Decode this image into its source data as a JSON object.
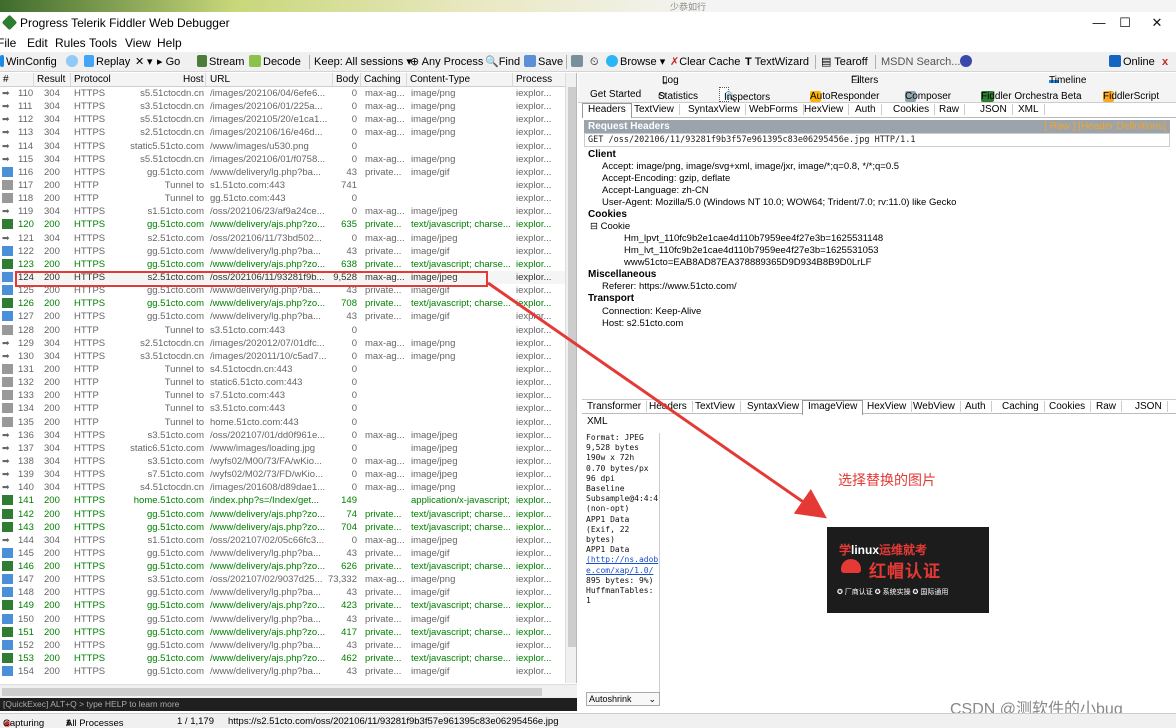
{
  "topstrip": {
    "mark": "少恭如行"
  },
  "window": {
    "title": "Progress Telerik Fiddler Web Debugger",
    "minimize": "—",
    "maximize": "☐",
    "close": "✕"
  },
  "menu": [
    "File",
    "Edit",
    "Rules",
    "Tools",
    "View",
    "Help"
  ],
  "toolbar": {
    "winconfig": "WinConfig",
    "replay": "Replay",
    "remove": "✕",
    "go": "Go",
    "stream": "Stream",
    "decode": "Decode",
    "keep": "Keep: All sessions",
    "any_process": "Any Process",
    "find": "Find",
    "save": "Save",
    "browse": "Browse",
    "clear_cache": "Clear Cache",
    "textwizard": "TextWizard",
    "tearoff": "Tearoff",
    "msdn_search": "MSDN Search...",
    "online": "Online",
    "close": "x"
  },
  "columns": [
    "#",
    "Result",
    "Protocol",
    "Host",
    "URL",
    "Body",
    "Caching",
    "Content-Type",
    "Process"
  ],
  "sessions": [
    {
      "id": "110",
      "result": "304",
      "protocol": "HTTPS",
      "host": "s5.51ctocdn.cn",
      "url": "/images/202106/04/6efe6...",
      "body": "0",
      "caching": "max-ag...",
      "ctype": "image/png",
      "process": "iexplor...",
      "style": "gray",
      "icon": "arrow"
    },
    {
      "id": "111",
      "result": "304",
      "protocol": "HTTPS",
      "host": "s3.51ctocdn.cn",
      "url": "/images/202106/01/225a...",
      "body": "0",
      "caching": "max-ag...",
      "ctype": "image/png",
      "process": "iexplor...",
      "style": "gray",
      "icon": "arrow"
    },
    {
      "id": "112",
      "result": "304",
      "protocol": "HTTPS",
      "host": "s5.51ctocdn.cn",
      "url": "/images/202105/20/e1ca1...",
      "body": "0",
      "caching": "max-ag...",
      "ctype": "image/png",
      "process": "iexplor...",
      "style": "gray",
      "icon": "arrow"
    },
    {
      "id": "113",
      "result": "304",
      "protocol": "HTTPS",
      "host": "s2.51ctocdn.cn",
      "url": "/images/202106/16/e46d...",
      "body": "0",
      "caching": "max-ag...",
      "ctype": "image/png",
      "process": "iexplor...",
      "style": "gray",
      "icon": "arrow"
    },
    {
      "id": "114",
      "result": "304",
      "protocol": "HTTPS",
      "host": "static5.51cto.com",
      "url": "/www/images/u530.png",
      "body": "0",
      "caching": "",
      "ctype": "",
      "process": "iexplor...",
      "style": "gray",
      "icon": "arrow"
    },
    {
      "id": "115",
      "result": "304",
      "protocol": "HTTPS",
      "host": "s5.51ctocdn.cn",
      "url": "/images/202106/01/f0758...",
      "body": "0",
      "caching": "max-ag...",
      "ctype": "image/png",
      "process": "iexplor...",
      "style": "gray",
      "icon": "arrow"
    },
    {
      "id": "116",
      "result": "200",
      "protocol": "HTTPS",
      "host": "gg.51cto.com",
      "url": "/www/delivery/lg.php?ba...",
      "body": "43",
      "caching": "private...",
      "ctype": "image/gif",
      "process": "iexplor...",
      "style": "gray",
      "icon": "img"
    },
    {
      "id": "117",
      "result": "200",
      "protocol": "HTTP",
      "host": "Tunnel to",
      "url": "s1.51cto.com:443",
      "body": "741",
      "caching": "",
      "ctype": "",
      "process": "iexplor...",
      "style": "gray",
      "icon": "lock"
    },
    {
      "id": "118",
      "result": "200",
      "protocol": "HTTP",
      "host": "Tunnel to",
      "url": "gg.51cto.com:443",
      "body": "0",
      "caching": "",
      "ctype": "",
      "process": "iexplor...",
      "style": "gray",
      "icon": "lock"
    },
    {
      "id": "119",
      "result": "304",
      "protocol": "HTTPS",
      "host": "s1.51cto.com",
      "url": "/oss/202106/23/af9a24ce...",
      "body": "0",
      "caching": "max-ag...",
      "ctype": "image/jpeg",
      "process": "iexplor...",
      "style": "gray",
      "icon": "arrow"
    },
    {
      "id": "120",
      "result": "200",
      "protocol": "HTTPS",
      "host": "gg.51cto.com",
      "url": "/www/delivery/ajs.php?zo...",
      "body": "635",
      "caching": "private...",
      "ctype": "text/javascript; charse...",
      "process": "iexplor...",
      "style": "green",
      "icon": "js"
    },
    {
      "id": "121",
      "result": "304",
      "protocol": "HTTPS",
      "host": "s2.51cto.com",
      "url": "/oss/202106/11/73bd502...",
      "body": "0",
      "caching": "max-ag...",
      "ctype": "image/jpeg",
      "process": "iexplor...",
      "style": "gray",
      "icon": "arrow"
    },
    {
      "id": "122",
      "result": "200",
      "protocol": "HTTPS",
      "host": "gg.51cto.com",
      "url": "/www/delivery/lg.php?ba...",
      "body": "43",
      "caching": "private...",
      "ctype": "image/gif",
      "process": "iexplor...",
      "style": "gray",
      "icon": "img"
    },
    {
      "id": "123",
      "result": "200",
      "protocol": "HTTPS",
      "host": "gg.51cto.com",
      "url": "/www/delivery/ajs.php?zo...",
      "body": "638",
      "caching": "private...",
      "ctype": "text/javascript; charse...",
      "process": "iexplor...",
      "style": "green",
      "icon": "js"
    },
    {
      "id": "124",
      "result": "200",
      "protocol": "HTTPS",
      "host": "s2.51cto.com",
      "url": "/oss/202106/11/93281f9b...",
      "body": "9,528",
      "caching": "max-ag...",
      "ctype": "image/jpeg",
      "process": "iexplor...",
      "style": "sel",
      "icon": "img"
    },
    {
      "id": "125",
      "result": "200",
      "protocol": "HTTPS",
      "host": "gg.51cto.com",
      "url": "/www/delivery/lg.php?ba...",
      "body": "43",
      "caching": "private...",
      "ctype": "image/gif",
      "process": "iexplor...",
      "style": "gray",
      "icon": "img"
    },
    {
      "id": "126",
      "result": "200",
      "protocol": "HTTPS",
      "host": "gg.51cto.com",
      "url": "/www/delivery/ajs.php?zo...",
      "body": "708",
      "caching": "private...",
      "ctype": "text/javascript; charse...",
      "process": "iexplor...",
      "style": "green",
      "icon": "js"
    },
    {
      "id": "127",
      "result": "200",
      "protocol": "HTTPS",
      "host": "gg.51cto.com",
      "url": "/www/delivery/lg.php?ba...",
      "body": "43",
      "caching": "private...",
      "ctype": "image/gif",
      "process": "iexplor...",
      "style": "gray",
      "icon": "img"
    },
    {
      "id": "128",
      "result": "200",
      "protocol": "HTTP",
      "host": "Tunnel to",
      "url": "s3.51cto.com:443",
      "body": "0",
      "caching": "",
      "ctype": "",
      "process": "iexplor...",
      "style": "gray",
      "icon": "lock"
    },
    {
      "id": "129",
      "result": "304",
      "protocol": "HTTPS",
      "host": "s2.51ctocdn.cn",
      "url": "/images/202012/07/01dfc...",
      "body": "0",
      "caching": "max-ag...",
      "ctype": "image/png",
      "process": "iexplor...",
      "style": "gray",
      "icon": "arrow"
    },
    {
      "id": "130",
      "result": "304",
      "protocol": "HTTPS",
      "host": "s3.51ctocdn.cn",
      "url": "/images/202011/10/c5ad7...",
      "body": "0",
      "caching": "max-ag...",
      "ctype": "image/png",
      "process": "iexplor...",
      "style": "gray",
      "icon": "arrow"
    },
    {
      "id": "131",
      "result": "200",
      "protocol": "HTTP",
      "host": "Tunnel to",
      "url": "s4.51ctocdn.cn:443",
      "body": "0",
      "caching": "",
      "ctype": "",
      "process": "iexplor...",
      "style": "gray",
      "icon": "lock"
    },
    {
      "id": "132",
      "result": "200",
      "protocol": "HTTP",
      "host": "Tunnel to",
      "url": "static6.51cto.com:443",
      "body": "0",
      "caching": "",
      "ctype": "",
      "process": "iexplor...",
      "style": "gray",
      "icon": "lock"
    },
    {
      "id": "133",
      "result": "200",
      "protocol": "HTTP",
      "host": "Tunnel to",
      "url": "s7.51cto.com:443",
      "body": "0",
      "caching": "",
      "ctype": "",
      "process": "iexplor...",
      "style": "gray",
      "icon": "lock"
    },
    {
      "id": "134",
      "result": "200",
      "protocol": "HTTP",
      "host": "Tunnel to",
      "url": "s3.51cto.com:443",
      "body": "0",
      "caching": "",
      "ctype": "",
      "process": "iexplor...",
      "style": "gray",
      "icon": "lock"
    },
    {
      "id": "135",
      "result": "200",
      "protocol": "HTTP",
      "host": "Tunnel to",
      "url": "home.51cto.com:443",
      "body": "0",
      "caching": "",
      "ctype": "",
      "process": "iexplor...",
      "style": "gray",
      "icon": "lock"
    },
    {
      "id": "136",
      "result": "304",
      "protocol": "HTTPS",
      "host": "s3.51cto.com",
      "url": "/oss/202107/01/dd0f961e...",
      "body": "0",
      "caching": "max-ag...",
      "ctype": "image/jpeg",
      "process": "iexplor...",
      "style": "gray",
      "icon": "arrow"
    },
    {
      "id": "137",
      "result": "304",
      "protocol": "HTTPS",
      "host": "static6.51cto.com",
      "url": "/www/images/loading.jpg",
      "body": "0",
      "caching": "",
      "ctype": "image/jpeg",
      "process": "iexplor...",
      "style": "gray",
      "icon": "arrow"
    },
    {
      "id": "138",
      "result": "304",
      "protocol": "HTTPS",
      "host": "s3.51cto.com",
      "url": "/wyfs02/M00/73/FA/wKio...",
      "body": "0",
      "caching": "max-ag...",
      "ctype": "image/jpeg",
      "process": "iexplor...",
      "style": "gray",
      "icon": "arrow"
    },
    {
      "id": "139",
      "result": "304",
      "protocol": "HTTPS",
      "host": "s7.51cto.com",
      "url": "/wyfs02/M02/73/FD/wKio...",
      "body": "0",
      "caching": "max-ag...",
      "ctype": "image/jpeg",
      "process": "iexplor...",
      "style": "gray",
      "icon": "arrow"
    },
    {
      "id": "140",
      "result": "304",
      "protocol": "HTTPS",
      "host": "s4.51ctocdn.cn",
      "url": "/images/201608/d89dae1...",
      "body": "0",
      "caching": "max-ag...",
      "ctype": "image/png",
      "process": "iexplor...",
      "style": "gray",
      "icon": "arrow"
    },
    {
      "id": "141",
      "result": "200",
      "protocol": "HTTPS",
      "host": "home.51cto.com",
      "url": "/index.php?s=/Index/get...",
      "body": "149",
      "caching": "",
      "ctype": "application/x-javascript;",
      "process": "iexplor...",
      "style": "green",
      "icon": "js"
    },
    {
      "id": "142",
      "result": "200",
      "protocol": "HTTPS",
      "host": "gg.51cto.com",
      "url": "/www/delivery/ajs.php?zo...",
      "body": "74",
      "caching": "private...",
      "ctype": "text/javascript; charse...",
      "process": "iexplor...",
      "style": "green",
      "icon": "js"
    },
    {
      "id": "143",
      "result": "200",
      "protocol": "HTTPS",
      "host": "gg.51cto.com",
      "url": "/www/delivery/ajs.php?zo...",
      "body": "704",
      "caching": "private...",
      "ctype": "text/javascript; charse...",
      "process": "iexplor...",
      "style": "green",
      "icon": "js"
    },
    {
      "id": "144",
      "result": "304",
      "protocol": "HTTPS",
      "host": "s1.51cto.com",
      "url": "/oss/202107/02/05c66fc3...",
      "body": "0",
      "caching": "max-ag...",
      "ctype": "image/jpeg",
      "process": "iexplor...",
      "style": "gray",
      "icon": "arrow"
    },
    {
      "id": "145",
      "result": "200",
      "protocol": "HTTPS",
      "host": "gg.51cto.com",
      "url": "/www/delivery/lg.php?ba...",
      "body": "43",
      "caching": "private...",
      "ctype": "image/gif",
      "process": "iexplor...",
      "style": "gray",
      "icon": "img"
    },
    {
      "id": "146",
      "result": "200",
      "protocol": "HTTPS",
      "host": "gg.51cto.com",
      "url": "/www/delivery/ajs.php?zo...",
      "body": "626",
      "caching": "private...",
      "ctype": "text/javascript; charse...",
      "process": "iexplor...",
      "style": "green",
      "icon": "js"
    },
    {
      "id": "147",
      "result": "200",
      "protocol": "HTTPS",
      "host": "s3.51cto.com",
      "url": "/oss/202107/02/9037d25...",
      "body": "73,332",
      "caching": "max-ag...",
      "ctype": "image/png",
      "process": "iexplor...",
      "style": "gray",
      "icon": "img"
    },
    {
      "id": "148",
      "result": "200",
      "protocol": "HTTPS",
      "host": "gg.51cto.com",
      "url": "/www/delivery/lg.php?ba...",
      "body": "43",
      "caching": "private...",
      "ctype": "image/gif",
      "process": "iexplor...",
      "style": "gray",
      "icon": "img"
    },
    {
      "id": "149",
      "result": "200",
      "protocol": "HTTPS",
      "host": "gg.51cto.com",
      "url": "/www/delivery/ajs.php?zo...",
      "body": "423",
      "caching": "private...",
      "ctype": "text/javascript; charse...",
      "process": "iexplor...",
      "style": "green",
      "icon": "js"
    },
    {
      "id": "150",
      "result": "200",
      "protocol": "HTTPS",
      "host": "gg.51cto.com",
      "url": "/www/delivery/lg.php?ba...",
      "body": "43",
      "caching": "private...",
      "ctype": "image/gif",
      "process": "iexplor...",
      "style": "gray",
      "icon": "img"
    },
    {
      "id": "151",
      "result": "200",
      "protocol": "HTTPS",
      "host": "gg.51cto.com",
      "url": "/www/delivery/ajs.php?zo...",
      "body": "417",
      "caching": "private...",
      "ctype": "text/javascript; charse...",
      "process": "iexplor...",
      "style": "green",
      "icon": "js"
    },
    {
      "id": "152",
      "result": "200",
      "protocol": "HTTPS",
      "host": "gg.51cto.com",
      "url": "/www/delivery/lg.php?ba...",
      "body": "43",
      "caching": "private...",
      "ctype": "image/gif",
      "process": "iexplor...",
      "style": "gray",
      "icon": "img"
    },
    {
      "id": "153",
      "result": "200",
      "protocol": "HTTPS",
      "host": "gg.51cto.com",
      "url": "/www/delivery/ajs.php?zo...",
      "body": "462",
      "caching": "private...",
      "ctype": "text/javascript; charse...",
      "process": "iexplor...",
      "style": "green",
      "icon": "js"
    },
    {
      "id": "154",
      "result": "200",
      "protocol": "HTTPS",
      "host": "gg.51cto.com",
      "url": "/www/delivery/lg.php?ba...",
      "body": "43",
      "caching": "private...",
      "ctype": "image/gif",
      "process": "iexplor...",
      "style": "gray",
      "icon": "img"
    }
  ],
  "quickexec": "[QuickExec] ALT+Q > type HELP to learn more",
  "inspector": {
    "top_tabs": {
      "log": "Log",
      "filters": "Filters",
      "timeline": "Timeline",
      "get_started": "Get Started",
      "statistics": "Statistics",
      "inspectors": "Inspectors",
      "autoresponder": "AutoResponder",
      "composer": "Composer",
      "orchestra": "Fiddler Orchestra Beta",
      "fiddlerscript": "FiddlerScript"
    },
    "request_tabs": [
      "Headers",
      "TextView",
      "SyntaxView",
      "WebForms",
      "HexView",
      "Auth",
      "Cookies",
      "Raw",
      "JSON",
      "XML"
    ],
    "request_headers_title": "Request Headers",
    "request_headers_links": "[ Raw ]  [Header Definitions]",
    "request_line": "GET /oss/202106/11/93281f9b3f57e961395c83e06295456e.jpg HTTP/1.1",
    "groups": {
      "client": "Client",
      "accept": "Accept: image/png, image/svg+xml, image/jxr, image/*;q=0.8, */*;q=0.5",
      "accept_encoding": "Accept-Encoding: gzip, deflate",
      "accept_language": "Accept-Language: zh-CN",
      "user_agent": "User-Agent: Mozilla/5.0 (Windows NT 10.0; WOW64; Trident/7.0; rv:11.0) like Gecko",
      "cookies": "Cookies",
      "cookie": "Cookie",
      "cookie1": "Hm_lpvt_110fc9b2e1cae4d110b7959ee4f27e3b=1625531148",
      "cookie2": "Hm_lvt_110fc9b2e1cae4d110b7959ee4f27e3b=1625531053",
      "cookie3": "www51cto=EAB8AD87EA378889365D9D934B8B9D0LrLF",
      "misc": "Miscellaneous",
      "referer": "Referer: https://www.51cto.com/",
      "transport": "Transport",
      "connection": "Connection: Keep-Alive",
      "host": "Host: s2.51cto.com"
    },
    "response_tabs": [
      "Transformer",
      "Headers",
      "TextView",
      "SyntaxView",
      "ImageView",
      "HexView",
      "WebView",
      "Auth",
      "Caching",
      "Cookies",
      "Raw",
      "JSON"
    ],
    "response_tab_xml": "XML",
    "image_info": [
      "Format: JPEG",
      "9,528 bytes",
      "",
      "190w x 72h",
      "0.70 bytes/px",
      "96 dpi",
      "Baseline",
      "Subsample@4:4:4",
      "(non-opt)",
      "APP1 Data",
      "(Exif, 22",
      "bytes)",
      "APP1 Data"
    ],
    "image_info_link": "(http://ns.adobe.com/xap/1.0/",
    "image_info_tail": [
      "895 bytes: 9%)",
      "HuffmanTables:",
      "1"
    ],
    "autoshrink": "Autoshrink",
    "annotation": "选择替换的图片",
    "preview": {
      "line1_a": "学",
      "line1_b": "linux",
      "line1_c": "运维就考",
      "line2": "红帽认证",
      "line3": "✪ 厂商认证  ✪ 系统实操  ✪ 国际通用"
    }
  },
  "watermark": "CSDN @测软件的小bug",
  "status": {
    "capturing": "Capturing",
    "processes": "All Processes",
    "count": "1 / 1,179",
    "url": "https://s2.51cto.com/oss/202106/11/93281f9b3f57e961395c83e06295456e.jpg"
  },
  "colors": {
    "highlight": "#e53935",
    "green_text": "#008000",
    "header_band": "#9ba3ad",
    "orange_link": "#f5a623"
  }
}
